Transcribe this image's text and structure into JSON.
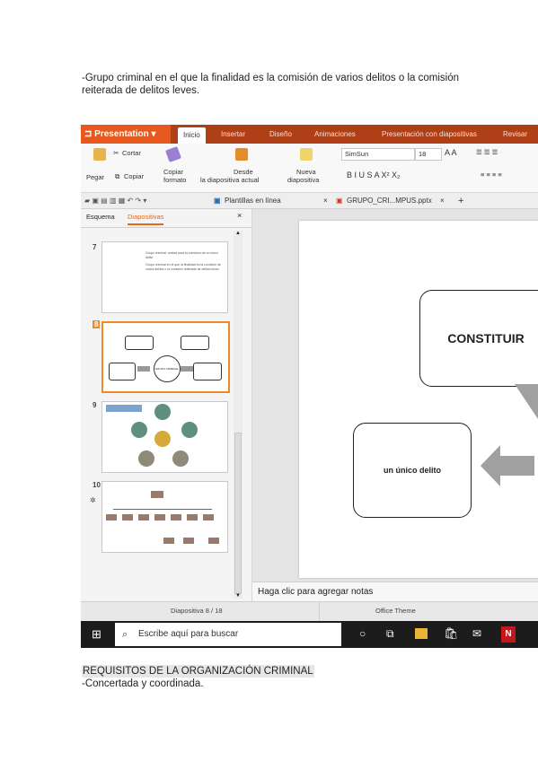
{
  "document": {
    "paragraph1": "-Grupo criminal en el que la finalidad es la comisión de varios delitos o la comisión reiterada de delitos leves.",
    "heading2": "REQUISITOS DE LA ORGANIZACIÓN CRIMINAL",
    "line2": "-Concertada y coordinada."
  },
  "app": {
    "name": "Presentation",
    "menu": [
      "Inicio",
      "Insertar",
      "Diseño",
      "Animaciones",
      "Presentación con diapositivas",
      "Revisar"
    ]
  },
  "ribbon": {
    "cut": "Cortar",
    "paste": "Pegar",
    "copy": "Copiar",
    "format_copy_1": "Copiar",
    "format_copy_2": "formato",
    "from_current_1": "Desde",
    "from_current_2": "la diapositiva actual",
    "new_slide_1": "Nueva",
    "new_slide_2": "diapositiva",
    "font_name": "SimSun",
    "font_size": "18"
  },
  "tabs": {
    "templates": "Plantillas en línea",
    "file": "GRUPO_CRI...MPUS.pptx"
  },
  "left_panel": {
    "tab_outline": "Esquema",
    "tab_slides": "Diapositivas",
    "slide_numbers": [
      "7",
      "8",
      "9",
      "10"
    ],
    "thumb7_text_a": "Grupo criminal: unidad para la comisión de un único delito",
    "thumb7_text_b": "Grupo criminal en el que la finalidad es la comisión de varios delitos o la comisión reiterada de delitos leves",
    "thumb8_center": "GRUPO CRIMINAL"
  },
  "slide": {
    "box1": "CONSTITUIR",
    "box2": "un único delito"
  },
  "notes": {
    "placeholder": "Haga clic para agregar notas"
  },
  "status": {
    "slide_info": "Diapositiva 8 / 18",
    "theme": "Office Theme"
  },
  "taskbar": {
    "search_placeholder": "Escribe aquí para buscar"
  },
  "colors": {
    "accent": "#e6581d",
    "menubar": "#ae3f17",
    "selection": "#f08a24",
    "thumb_circle_green": "#5f8f7f",
    "thumb_circle_gold": "#d6a93b"
  }
}
